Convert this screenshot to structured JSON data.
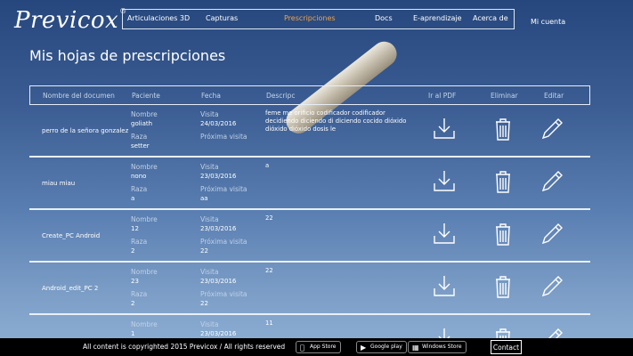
{
  "brand": {
    "logo": "Previcox",
    "reg": "®"
  },
  "nav": {
    "items": [
      "Articulaciones 3D",
      "Capturas",
      "Prescripciones",
      "Docs",
      "E-aprendizaje",
      "Acerca de"
    ],
    "active": "Prescripciones",
    "active_color": "#f0a24a",
    "account": "Mi cuenta"
  },
  "page": {
    "title": "Mis hojas de prescripciones"
  },
  "table": {
    "headers": [
      "Nombre del documen",
      "Paciente",
      "Fecha",
      "Descripc",
      "Ir al PDF",
      "Eliminar",
      "Editar"
    ],
    "labels": {
      "nombre": "Nombre",
      "raza": "Raza",
      "visita": "Visita",
      "proxima": "Próxima visita"
    },
    "rows": [
      {
        "name": "perro de la señora gonzalez",
        "nombre": "goliath",
        "raza": "setter",
        "visita": "24/03/2016",
        "proxima": "",
        "desc": "feme me orificio codificador codificador decidiendo diciendo di diciendo cocido dióxido dióxido dióxido dosis le"
      },
      {
        "name": "miau miau",
        "nombre": "nono",
        "raza": "a",
        "visita": "23/03/2016",
        "proxima": "aa",
        "desc": "a"
      },
      {
        "name": "Create_PC Android",
        "nombre": "12",
        "raza": "2",
        "visita": "23/03/2016",
        "proxima": "22",
        "desc": "22"
      },
      {
        "name": "Android_edit_PC 2",
        "nombre": "23",
        "raza": "2",
        "visita": "23/03/2016",
        "proxima": "22",
        "desc": "22"
      },
      {
        "name": "",
        "nombre": "1",
        "raza": "",
        "visita": "23/03/2016",
        "proxima": "",
        "desc": "11"
      }
    ],
    "icons": [
      "download-icon",
      "trash-icon",
      "pencil-icon"
    ]
  },
  "footer": {
    "copyright": "All content is copyrighted 2015 Previcox / All rights reserved",
    "stores": [
      "App Store",
      "Google play",
      "Windows Store"
    ],
    "contact": "Contact"
  }
}
